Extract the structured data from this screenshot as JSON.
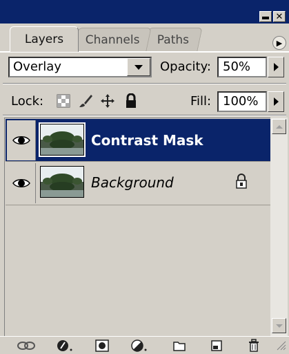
{
  "panel": {
    "tabs": [
      {
        "label": "Layers",
        "active": true
      },
      {
        "label": "Channels",
        "active": false
      },
      {
        "label": "Paths",
        "active": false
      }
    ]
  },
  "controls": {
    "blend_mode": "Overlay",
    "opacity_label": "Opacity:",
    "opacity_value": "50%",
    "lock_label": "Lock:",
    "fill_label": "Fill:",
    "fill_value": "100%"
  },
  "layers": [
    {
      "name": "Contrast Mask",
      "selected": true,
      "visible": true,
      "locked": false
    },
    {
      "name": "Background",
      "selected": false,
      "visible": true,
      "locked": true
    }
  ],
  "toolbar_icons": [
    "link-icon",
    "layer-style-icon",
    "layer-mask-icon",
    "adjustment-layer-icon",
    "new-group-icon",
    "new-layer-icon",
    "trash-icon"
  ],
  "colors": {
    "title_bar": "#0a246a",
    "selection": "#0a246a",
    "panel_bg": "#d4d0c8"
  }
}
